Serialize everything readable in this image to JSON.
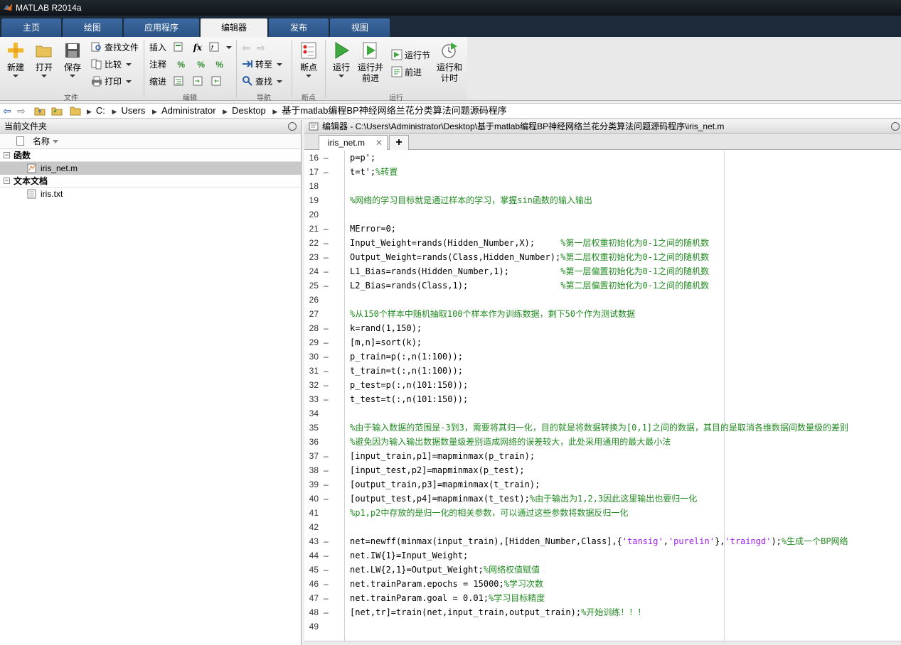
{
  "window": {
    "title": "MATLAB R2014a"
  },
  "tabs": [
    {
      "label": "主页"
    },
    {
      "label": "绘图"
    },
    {
      "label": "应用程序"
    },
    {
      "label": "编辑器"
    },
    {
      "label": "发布"
    },
    {
      "label": "视图"
    }
  ],
  "active_tab": "编辑器",
  "ribbon": {
    "file_group": {
      "label": "文件",
      "new": "新建",
      "open": "打开",
      "save": "保存",
      "find_files": "查找文件",
      "compare": "比较",
      "print": "打印"
    },
    "edit_group": {
      "label": "编辑",
      "insert": "插入",
      "comment": "注释",
      "indent": "缩进"
    },
    "nav_group": {
      "label": "导航",
      "goto": "转至",
      "find": "查找"
    },
    "breakpoint_group": {
      "label": "断点",
      "breakpoints": "断点"
    },
    "run_group": {
      "label": "运行",
      "run": "运行",
      "run_advance": "运行并\n前进",
      "run_section": "运行节",
      "advance": "前进",
      "run_time": "运行和\n计时"
    }
  },
  "address": {
    "crumbs": [
      "C:",
      "Users",
      "Administrator",
      "Desktop",
      "基于matlab编程BP神经网络兰花分类算法问题源码程序"
    ]
  },
  "current_folder": {
    "title": "当前文件夹",
    "column_name": "名称",
    "groups": [
      {
        "label": "函数",
        "files": [
          "iris_net.m"
        ]
      },
      {
        "label": "文本文档",
        "files": [
          "iris.txt"
        ]
      }
    ]
  },
  "editor": {
    "title": "编辑器 - C:\\Users\\Administrator\\Desktop\\基于matlab编程BP神经网络兰花分类算法问题源码程序\\iris_net.m",
    "tab": "iris_net.m",
    "add_tab": "+",
    "lines": [
      {
        "n": "16",
        "dash": true,
        "code": "p=p';"
      },
      {
        "n": "17",
        "dash": true,
        "code": "t=t';",
        "comment": "%转置"
      },
      {
        "n": "18",
        "dash": false,
        "code": ""
      },
      {
        "n": "19",
        "dash": false,
        "code": "",
        "comment": "%网络的学习目标就是通过样本的学习，掌握sin函数的输入输出"
      },
      {
        "n": "20",
        "dash": false,
        "code": ""
      },
      {
        "n": "21",
        "dash": true,
        "code": "MError=0;"
      },
      {
        "n": "22",
        "dash": true,
        "code": "Input_Weight=rands(Hidden_Number,X);     ",
        "comment": "%第一层权重初始化为0-1之间的随机数"
      },
      {
        "n": "23",
        "dash": true,
        "code": "Output_Weight=rands(Class,Hidden_Number);",
        "comment": "%第二层权重初始化为0-1之间的随机数"
      },
      {
        "n": "24",
        "dash": true,
        "code": "L1_Bias=rands(Hidden_Number,1);          ",
        "comment": "%第一层偏置初始化为0-1之间的随机数"
      },
      {
        "n": "25",
        "dash": true,
        "code": "L2_Bias=rands(Class,1);                  ",
        "comment": "%第二层偏置初始化为0-1之间的随机数"
      },
      {
        "n": "26",
        "dash": false,
        "code": ""
      },
      {
        "n": "27",
        "dash": false,
        "code": "",
        "comment": "%从150个样本中随机抽取100个样本作为训练数据，剩下50个作为测试数据"
      },
      {
        "n": "28",
        "dash": true,
        "code": "k=rand(1,150);"
      },
      {
        "n": "29",
        "dash": true,
        "code": "[m,n]=sort(k);"
      },
      {
        "n": "30",
        "dash": true,
        "code": "p_train=p(:,n(1:100));"
      },
      {
        "n": "31",
        "dash": true,
        "code": "t_train=t(:,n(1:100));"
      },
      {
        "n": "32",
        "dash": true,
        "code": "p_test=p(:,n(101:150));"
      },
      {
        "n": "33",
        "dash": true,
        "code": "t_test=t(:,n(101:150));"
      },
      {
        "n": "34",
        "dash": false,
        "code": ""
      },
      {
        "n": "35",
        "dash": false,
        "code": "",
        "comment": "%由于输入数据的范围是-3到3，需要将其归一化，目的就是将数据转换为[0,1]之间的数据，其目的是取消各维数据间数量级的差别"
      },
      {
        "n": "36",
        "dash": false,
        "code": "",
        "comment": "%避免因为输入输出数据数量级差别造成网络的误差较大，此处采用通用的最大最小法"
      },
      {
        "n": "37",
        "dash": true,
        "code": "[input_train,p1]=mapminmax(p_train);"
      },
      {
        "n": "38",
        "dash": true,
        "code": "[input_test,p2]=mapminmax(p_test);"
      },
      {
        "n": "39",
        "dash": true,
        "code": "[output_train,p3]=mapminmax(t_train);"
      },
      {
        "n": "40",
        "dash": true,
        "code": "[output_test,p4]=mapminmax(t_test);",
        "comment": "%由于输出为1,2,3因此这里输出也要归一化"
      },
      {
        "n": "41",
        "dash": false,
        "code": "",
        "comment": "%p1,p2中存放的是归一化的相关参数，可以通过这些参数将数据反归一化"
      },
      {
        "n": "42",
        "dash": false,
        "code": ""
      },
      {
        "n": "43",
        "dash": true,
        "code": "net=newff(minmax(input_train),[Hidden_Number,Class],{",
        "s1": "'tansig'",
        "m1": ",",
        "s2": "'purelin'",
        "m2": "},",
        "s3": "'traingd'",
        "m3": ");",
        "comment": "%生成一个BP网络"
      },
      {
        "n": "44",
        "dash": true,
        "code": "net.IW{1}=Input_Weight;"
      },
      {
        "n": "45",
        "dash": true,
        "code": "net.LW{2,1}=Output_Weight;",
        "comment": "%网络权值赋值"
      },
      {
        "n": "46",
        "dash": true,
        "code": "net.trainParam.epochs = 15000;",
        "comment": "%学习次数"
      },
      {
        "n": "47",
        "dash": true,
        "code": "net.trainParam.goal = 0.01;",
        "comment": "%学习目标精度"
      },
      {
        "n": "48",
        "dash": true,
        "code": "[net,tr]=train(net,input_train,output_train);",
        "comment": "%开始训练！！！"
      },
      {
        "n": "49",
        "dash": false,
        "code": ""
      }
    ]
  },
  "colors": {
    "comment": "#228b22",
    "string": "#a020f0",
    "tab_blue": "#2b5486",
    "selection": "#c8c8c8"
  },
  "icons": [
    "matlab-logo-icon",
    "new-icon",
    "open-icon",
    "save-icon",
    "find-files-icon",
    "compare-icon",
    "print-icon",
    "insert-icon",
    "fx-icon",
    "comment-icon",
    "indent-icon",
    "back-icon",
    "forward-icon",
    "goto-icon",
    "find-icon",
    "breakpoint-icon",
    "run-icon",
    "run-advance-icon",
    "run-section-icon",
    "advance-icon",
    "run-time-icon",
    "folder-icon",
    "m-file-icon",
    "txt-file-icon"
  ]
}
